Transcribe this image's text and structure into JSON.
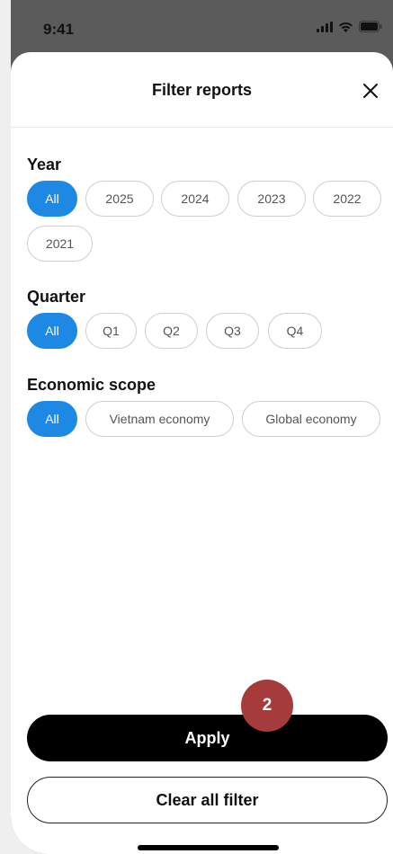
{
  "status_bar": {
    "time": "9:41",
    "icons": [
      "signal-icon",
      "wifi-icon",
      "battery-icon"
    ]
  },
  "sheet": {
    "title": "Filter reports",
    "close_icon": "close-icon"
  },
  "filters": {
    "year": {
      "title": "Year",
      "options": [
        "All",
        "2025",
        "2024",
        "2023",
        "2022",
        "2021"
      ],
      "selected": "All"
    },
    "quarter": {
      "title": "Quarter",
      "options": [
        "All",
        "Q1",
        "Q2",
        "Q3",
        "Q4"
      ],
      "selected": "All"
    },
    "scope": {
      "title": "Economic scope",
      "options": [
        "All",
        "Vietnam economy",
        "Global economy"
      ],
      "selected": "All"
    }
  },
  "actions": {
    "apply_label": "Apply",
    "clear_label": "Clear all filter"
  },
  "step_badge": "2",
  "colors": {
    "accent": "#1e88e5",
    "badge": "#a53b3b",
    "primary_button": "#000000"
  }
}
